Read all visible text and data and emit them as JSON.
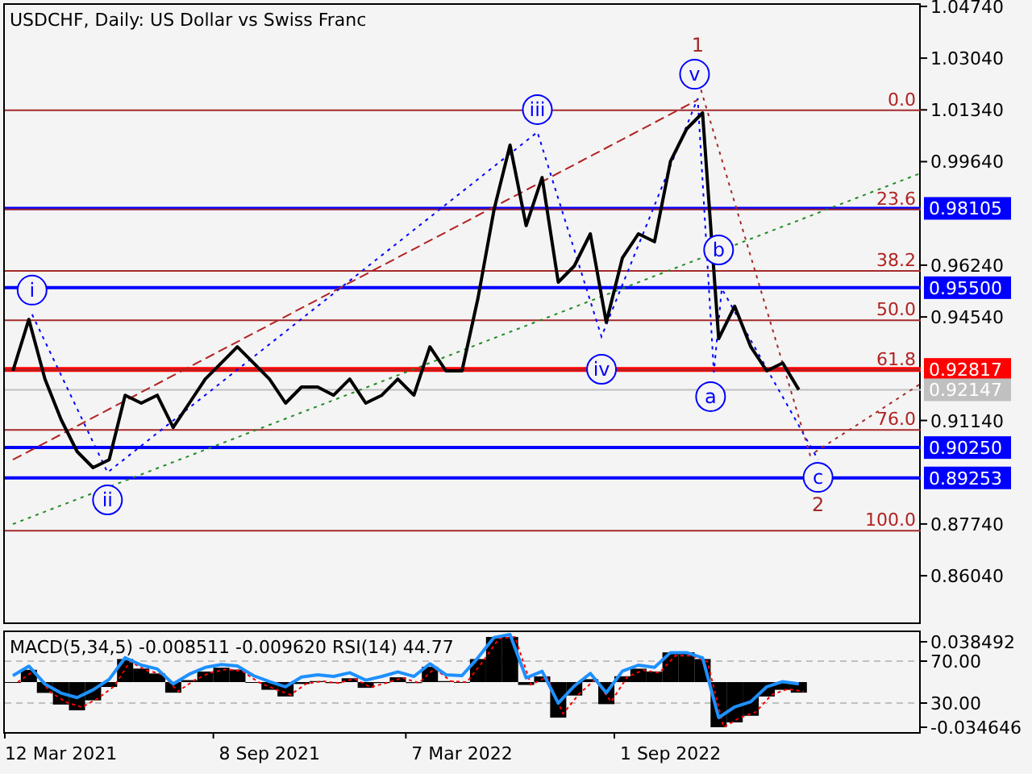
{
  "title": "USDCHF, Daily:  US Dollar vs Swiss Franc",
  "price_chart": {
    "chart_data": {
      "type": "line",
      "categories": [
        null,
        null,
        null,
        "12 Mar 2021",
        null,
        null,
        null,
        null,
        null,
        null,
        null,
        null,
        null,
        null,
        null,
        null,
        "8 Sep 2021",
        null,
        null,
        null,
        null,
        null,
        null,
        null,
        null,
        null,
        null,
        null,
        "7 Mar 2022",
        null,
        null,
        null,
        null,
        null,
        null,
        null,
        null,
        null,
        null,
        null,
        null,
        "1 Sep 2022",
        null,
        null,
        null,
        null,
        null,
        null,
        null,
        null,
        null,
        null,
        null,
        null,
        null,
        null,
        null
      ],
      "series": [
        {
          "color": "#000000",
          "values": [
            0.9277,
            0.9446,
            0.925,
            0.9118,
            0.9012,
            0.8959,
            0.8985,
            0.9197,
            0.9171,
            0.9197,
            0.9091,
            0.9171,
            0.925,
            0.9303,
            0.9356,
            0.9303,
            0.925,
            0.9171,
            0.9224,
            0.9224,
            0.9197,
            0.925,
            0.9171,
            0.9197,
            0.925,
            0.9197,
            0.9356,
            0.9277,
            0.9277,
            0.9515,
            0.9807,
            1.0018,
            0.9754,
            0.9912,
            0.9568,
            0.9621,
            0.9727,
            0.9436,
            0.9648,
            0.9727,
            0.9701,
            0.9965,
            1.0071,
            1.0124,
            0.9383,
            0.9489,
            0.9356,
            0.9277,
            0.9303,
            0.9215,
            null,
            null,
            null,
            null,
            null,
            null,
            null
          ]
        }
      ],
      "ylim": [
        0.8456,
        1.0479
      ],
      "yticks": [
        {
          "value": 1.0474,
          "label": "1.04740"
        },
        {
          "value": 1.0304,
          "label": "1.03040"
        },
        {
          "value": 1.0134,
          "label": "1.01340"
        },
        {
          "value": 0.9964,
          "label": "0.99640"
        },
        {
          "value": 0.9624,
          "label": "0.96240"
        },
        {
          "value": 0.9454,
          "label": "0.94540"
        },
        {
          "value": 0.9114,
          "label": "0.91140"
        },
        {
          "value": 0.8774,
          "label": "0.87740"
        },
        {
          "value": 0.8604,
          "label": "0.86040"
        }
      ],
      "ref_lines": [
        {
          "axis": "y",
          "value": 1.0133,
          "color": "#a52a2a"
        },
        {
          "axis": "y",
          "value": 0.9807,
          "color": "#a52a2a"
        },
        {
          "axis": "y",
          "value": 0.9605,
          "color": "#a52a2a"
        },
        {
          "axis": "y",
          "value": 0.9443,
          "color": "#a52a2a"
        },
        {
          "axis": "y",
          "value": 0.928,
          "color": "#a52a2a"
        },
        {
          "axis": "y",
          "value": 0.9083,
          "color": "#a52a2a"
        },
        {
          "axis": "y",
          "value": 0.8752,
          "color": "#a52a2a"
        },
        {
          "axis": "y",
          "value": 0.98105,
          "label": "0.98105",
          "color": "#0000ff"
        },
        {
          "axis": "y",
          "value": 0.955,
          "label": "0.95500",
          "color": "#0000ff"
        },
        {
          "axis": "y",
          "value": 0.92817,
          "label": "0.92817",
          "color": "#ff0000"
        },
        {
          "axis": "y",
          "value": 0.92147,
          "label": "0.92147",
          "color": "#c0c0c0"
        },
        {
          "axis": "y",
          "value": 0.9025,
          "label": "0.90250",
          "color": "#0000ff"
        },
        {
          "axis": "y",
          "value": 0.89253,
          "label": "0.89253",
          "color": "#0000ff"
        }
      ]
    },
    "fibonacci_labels": [
      "0.0",
      "23.6",
      "38.2",
      "50.0",
      "61.8",
      "76.0",
      "100.0"
    ],
    "wave_labels": [
      {
        "label": "i",
        "circled": true
      },
      {
        "label": "ii",
        "circled": true
      },
      {
        "label": "iii",
        "circled": true
      },
      {
        "label": "iv",
        "circled": true
      },
      {
        "label": "v",
        "circled": true
      },
      {
        "label": "a",
        "circled": true
      },
      {
        "label": "b",
        "circled": true
      },
      {
        "label": "c",
        "circled": true
      },
      {
        "label": "1",
        "circled": false
      },
      {
        "label": "2",
        "circled": false
      }
    ]
  },
  "indicator": {
    "label": "MACD(5,34,5) -0.008511 -0.009620 RSI(14) 44.77",
    "ticks": [
      "0.038492",
      "70.00",
      "30.00",
      "-0.034646"
    ]
  }
}
